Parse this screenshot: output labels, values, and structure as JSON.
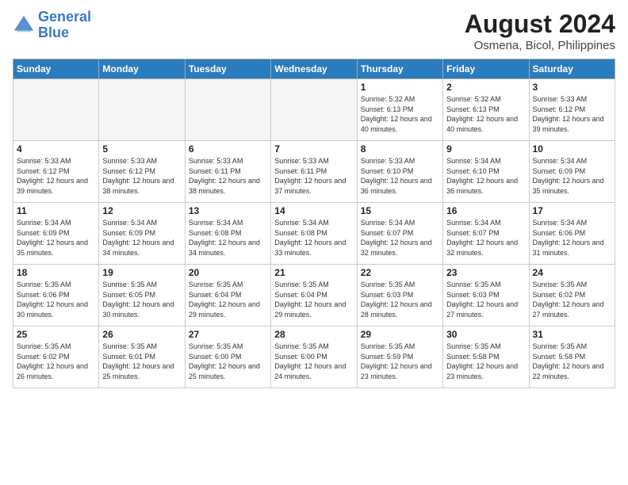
{
  "header": {
    "logo_line1": "General",
    "logo_line2": "Blue",
    "month": "August 2024",
    "location": "Osmena, Bicol, Philippines"
  },
  "weekdays": [
    "Sunday",
    "Monday",
    "Tuesday",
    "Wednesday",
    "Thursday",
    "Friday",
    "Saturday"
  ],
  "weeks": [
    [
      {
        "day": "",
        "info": ""
      },
      {
        "day": "",
        "info": ""
      },
      {
        "day": "",
        "info": ""
      },
      {
        "day": "",
        "info": ""
      },
      {
        "day": "1",
        "info": "Sunrise: 5:32 AM\nSunset: 6:13 PM\nDaylight: 12 hours\nand 40 minutes."
      },
      {
        "day": "2",
        "info": "Sunrise: 5:32 AM\nSunset: 6:13 PM\nDaylight: 12 hours\nand 40 minutes."
      },
      {
        "day": "3",
        "info": "Sunrise: 5:33 AM\nSunset: 6:12 PM\nDaylight: 12 hours\nand 39 minutes."
      }
    ],
    [
      {
        "day": "4",
        "info": "Sunrise: 5:33 AM\nSunset: 6:12 PM\nDaylight: 12 hours\nand 39 minutes."
      },
      {
        "day": "5",
        "info": "Sunrise: 5:33 AM\nSunset: 6:12 PM\nDaylight: 12 hours\nand 38 minutes."
      },
      {
        "day": "6",
        "info": "Sunrise: 5:33 AM\nSunset: 6:11 PM\nDaylight: 12 hours\nand 38 minutes."
      },
      {
        "day": "7",
        "info": "Sunrise: 5:33 AM\nSunset: 6:11 PM\nDaylight: 12 hours\nand 37 minutes."
      },
      {
        "day": "8",
        "info": "Sunrise: 5:33 AM\nSunset: 6:10 PM\nDaylight: 12 hours\nand 36 minutes."
      },
      {
        "day": "9",
        "info": "Sunrise: 5:34 AM\nSunset: 6:10 PM\nDaylight: 12 hours\nand 36 minutes."
      },
      {
        "day": "10",
        "info": "Sunrise: 5:34 AM\nSunset: 6:09 PM\nDaylight: 12 hours\nand 35 minutes."
      }
    ],
    [
      {
        "day": "11",
        "info": "Sunrise: 5:34 AM\nSunset: 6:09 PM\nDaylight: 12 hours\nand 35 minutes."
      },
      {
        "day": "12",
        "info": "Sunrise: 5:34 AM\nSunset: 6:09 PM\nDaylight: 12 hours\nand 34 minutes."
      },
      {
        "day": "13",
        "info": "Sunrise: 5:34 AM\nSunset: 6:08 PM\nDaylight: 12 hours\nand 34 minutes."
      },
      {
        "day": "14",
        "info": "Sunrise: 5:34 AM\nSunset: 6:08 PM\nDaylight: 12 hours\nand 33 minutes."
      },
      {
        "day": "15",
        "info": "Sunrise: 5:34 AM\nSunset: 6:07 PM\nDaylight: 12 hours\nand 32 minutes."
      },
      {
        "day": "16",
        "info": "Sunrise: 5:34 AM\nSunset: 6:07 PM\nDaylight: 12 hours\nand 32 minutes."
      },
      {
        "day": "17",
        "info": "Sunrise: 5:34 AM\nSunset: 6:06 PM\nDaylight: 12 hours\nand 31 minutes."
      }
    ],
    [
      {
        "day": "18",
        "info": "Sunrise: 5:35 AM\nSunset: 6:06 PM\nDaylight: 12 hours\nand 30 minutes."
      },
      {
        "day": "19",
        "info": "Sunrise: 5:35 AM\nSunset: 6:05 PM\nDaylight: 12 hours\nand 30 minutes."
      },
      {
        "day": "20",
        "info": "Sunrise: 5:35 AM\nSunset: 6:04 PM\nDaylight: 12 hours\nand 29 minutes."
      },
      {
        "day": "21",
        "info": "Sunrise: 5:35 AM\nSunset: 6:04 PM\nDaylight: 12 hours\nand 29 minutes."
      },
      {
        "day": "22",
        "info": "Sunrise: 5:35 AM\nSunset: 6:03 PM\nDaylight: 12 hours\nand 28 minutes."
      },
      {
        "day": "23",
        "info": "Sunrise: 5:35 AM\nSunset: 6:03 PM\nDaylight: 12 hours\nand 27 minutes."
      },
      {
        "day": "24",
        "info": "Sunrise: 5:35 AM\nSunset: 6:02 PM\nDaylight: 12 hours\nand 27 minutes."
      }
    ],
    [
      {
        "day": "25",
        "info": "Sunrise: 5:35 AM\nSunset: 6:02 PM\nDaylight: 12 hours\nand 26 minutes."
      },
      {
        "day": "26",
        "info": "Sunrise: 5:35 AM\nSunset: 6:01 PM\nDaylight: 12 hours\nand 25 minutes."
      },
      {
        "day": "27",
        "info": "Sunrise: 5:35 AM\nSunset: 6:00 PM\nDaylight: 12 hours\nand 25 minutes."
      },
      {
        "day": "28",
        "info": "Sunrise: 5:35 AM\nSunset: 6:00 PM\nDaylight: 12 hours\nand 24 minutes."
      },
      {
        "day": "29",
        "info": "Sunrise: 5:35 AM\nSunset: 5:59 PM\nDaylight: 12 hours\nand 23 minutes."
      },
      {
        "day": "30",
        "info": "Sunrise: 5:35 AM\nSunset: 5:58 PM\nDaylight: 12 hours\nand 23 minutes."
      },
      {
        "day": "31",
        "info": "Sunrise: 5:35 AM\nSunset: 5:58 PM\nDaylight: 12 hours\nand 22 minutes."
      }
    ]
  ]
}
